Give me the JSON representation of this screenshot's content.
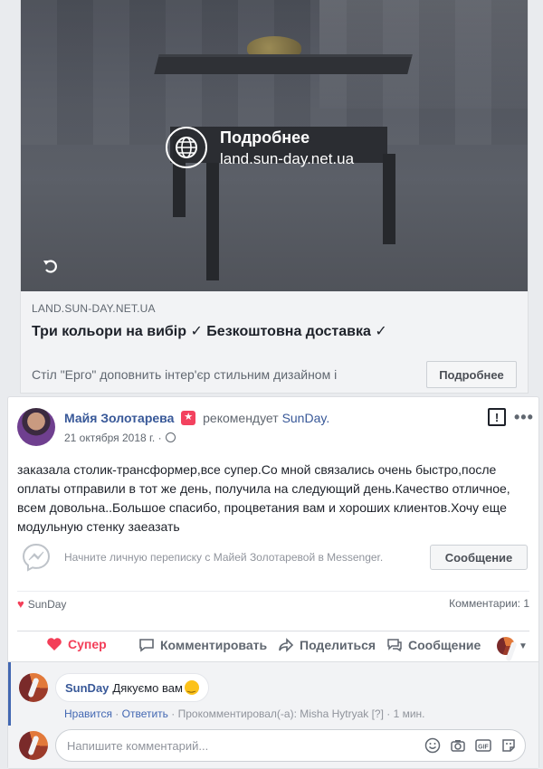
{
  "ad": {
    "overlay_title": "Подробнее",
    "overlay_url": "land.sun-day.net.ua",
    "domain": "LAND.SUN-DAY.NET.UA",
    "headline": "Три кольори на вибір ✓ Безкоштовна доставка ✓",
    "description": "Стіл \"Eрго\" доповнить інтер'єр стильним дизайном і",
    "cta_label": "Подробнее"
  },
  "review": {
    "author": "Майя Золотарева",
    "recommends_text": "рекомендует",
    "page_name": "SunDay.",
    "date": "21 октября 2018 г. ·",
    "text": "заказала столик-трансформер,все супер.Со мной связались очень быстро,после оплаты отправили в тот же день, получила на следующий день.Качество отличное, всем довольна..Большое спасибо, процветания вам и хороших клиентов.Хочу еще модульную стенку заеазать"
  },
  "messenger": {
    "prompt": "Начните личную переписку с Майей Золотаревой в Messenger.",
    "button_label": "Сообщение"
  },
  "stats": {
    "reactor": "SunDay",
    "comments": "Комментарии: 1"
  },
  "actions": {
    "love": "Супер",
    "comment": "Комментировать",
    "share": "Поделиться",
    "message": "Сообщение"
  },
  "comment": {
    "author": "SunDay",
    "text": "Дякуємо вам",
    "like_link": "Нравится",
    "reply_link": "Ответить",
    "meta": "· Прокомментировал(-а): Misha Hytryak [?] · 1 мин.",
    "separator": "·"
  },
  "compose": {
    "placeholder": "Напишите комментарий..."
  },
  "colors": {
    "link_blue": "#385898",
    "love_red": "#f33e58",
    "marker_blue": "#4267b2"
  }
}
